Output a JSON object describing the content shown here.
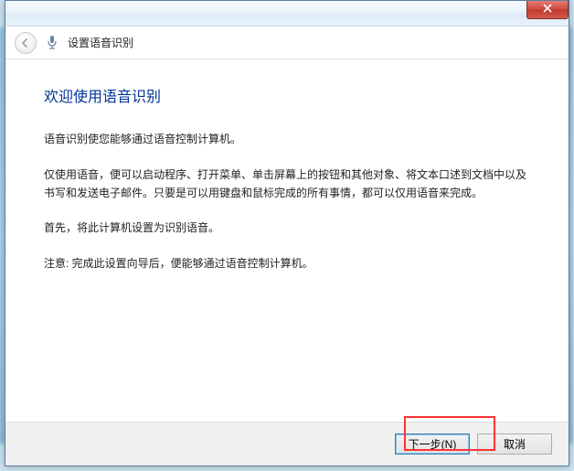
{
  "window": {
    "title": "设置语音识别"
  },
  "content": {
    "heading": "欢迎使用语音识别",
    "p1": "语音识别使您能够通过语音控制计算机。",
    "p2": "仅使用语音，便可以启动程序、打开菜单、单击屏幕上的按钮和其他对象、将文本口述到文档中以及书写和发送电子邮件。只要是可以用键盘和鼠标完成的所有事情，都可以仅用语音来完成。",
    "p3": "首先，将此计算机设置为识别语音。",
    "p4": "注意: 完成此设置向导后，便能够通过语音控制计算机。"
  },
  "buttons": {
    "next": "下一步(N)",
    "cancel": "取消"
  }
}
